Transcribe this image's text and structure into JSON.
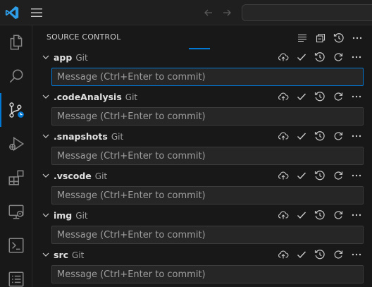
{
  "titlebar": {
    "logo": "vscode-logo-icon",
    "menu": "hamburger-menu-icon",
    "back": "arrow-left-icon",
    "forward": "arrow-right-icon",
    "search_value": ""
  },
  "activity": [
    "files-icon",
    "search-icon",
    "source-control-icon",
    "run-debug-icon",
    "extensions-icon",
    "remote-explorer-icon",
    "terminal-icon",
    "list-icon"
  ],
  "sidebar": {
    "title": "SOURCE CONTROL",
    "header_actions": [
      "view-as-list-icon",
      "collapse-all-icon",
      "history-icon",
      "more-actions-icon"
    ]
  },
  "repos": [
    {
      "name": "app",
      "provider": "Git",
      "placeholder": "Message (Ctrl+Enter to commit)",
      "message": ""
    },
    {
      "name": ".codeAnalysis",
      "provider": "Git",
      "placeholder": "Message (Ctrl+Enter to commit)",
      "message": ""
    },
    {
      "name": ".snapshots",
      "provider": "Git",
      "placeholder": "Message (Ctrl+Enter to commit)",
      "message": ""
    },
    {
      "name": ".vscode",
      "provider": "Git",
      "placeholder": "Message (Ctrl+Enter to commit)",
      "message": ""
    },
    {
      "name": "img",
      "provider": "Git",
      "placeholder": "Message (Ctrl+Enter to commit)",
      "message": ""
    },
    {
      "name": "src",
      "provider": "Git",
      "placeholder": "Message (Ctrl+Enter to commit)",
      "message": ""
    }
  ],
  "repo_actions": [
    "cloud-upload-icon",
    "check-icon",
    "history-icon",
    "refresh-icon",
    "more-actions-icon"
  ],
  "colors": {
    "accent": "#0078d4",
    "background": "#181818",
    "input_background": "#262626"
  }
}
